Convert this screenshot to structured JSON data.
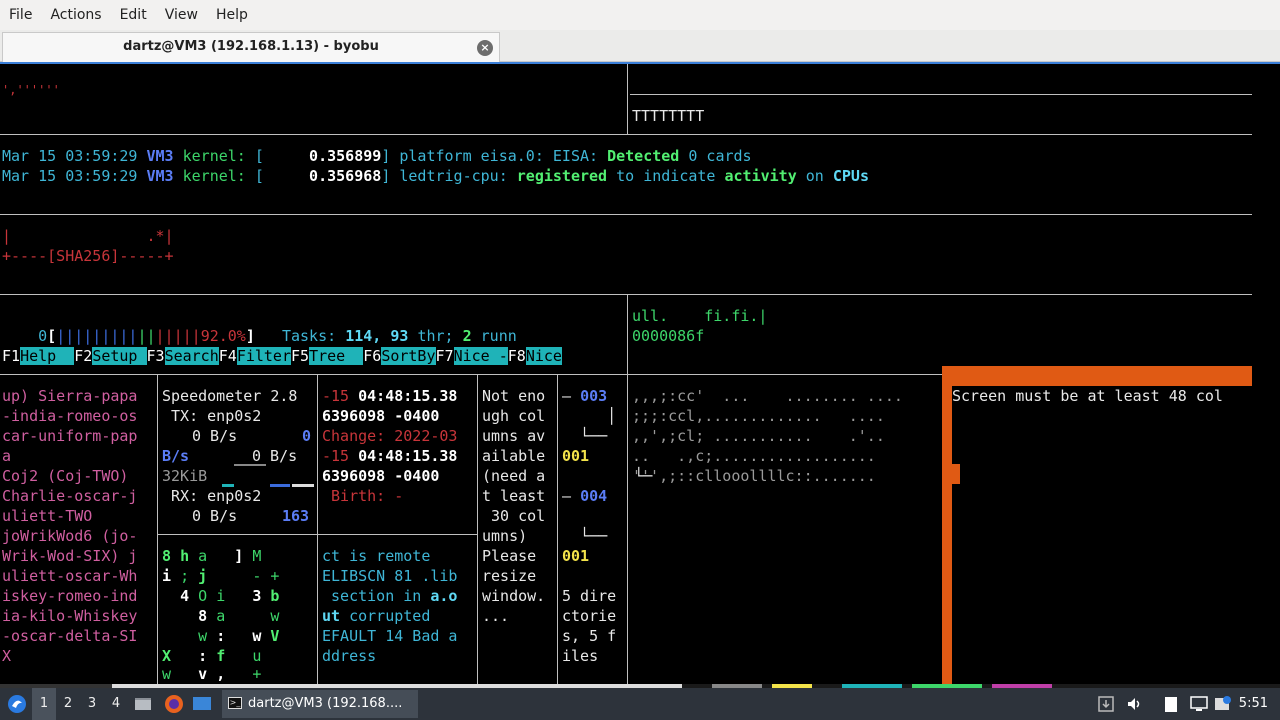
{
  "menu": [
    "File",
    "Actions",
    "Edit",
    "View",
    "Help"
  ],
  "tab": {
    "title": "dartz@VM3 (192.168.1.13) - byobu",
    "close": "×"
  },
  "pane_top": {
    "left_fragment": "',''''''",
    "right_text": "TTTTTTTT"
  },
  "log": [
    {
      "date": "Mar 15 03:59:29",
      "host": "VM3",
      "src": "kernel:",
      "open": "[",
      "time": "    0.356899",
      "close": "]",
      "msg1": "platform eisa.0: EISA:",
      "hl1": "Detected",
      "msg2": "0 cards",
      "hl2": "",
      "msg3": "",
      "hl3": ""
    },
    {
      "date": "Mar 15 03:59:29",
      "host": "VM3",
      "src": "kernel:",
      "open": "[",
      "time": "    0.356968",
      "close": "]",
      "msg1": "ledtrig-cpu:",
      "hl1": "registered",
      "msg2": "to indicate",
      "hl2": "activity",
      "msg3": "on",
      "hl3": "CPUs"
    }
  ],
  "sha": {
    "line1": "|               .*|",
    "line2": "+----[SHA256]-----+"
  },
  "htop": {
    "cpu_index": "0",
    "cpu_bar_open": "[",
    "cpu_bar_blue": "|||||||||",
    "cpu_bar_green": "||",
    "cpu_bar_red": "|||||",
    "cpu_pct": "92.0%",
    "cpu_bar_close": "]",
    "tasks_label": "Tasks:",
    "tasks_count": "114,",
    "threads": "93",
    "thr_label": "thr;",
    "running": "2",
    "run_label": "runn",
    "fkeys": [
      {
        "key": "F1",
        "label": "Help  "
      },
      {
        "key": "F2",
        "label": "Setup "
      },
      {
        "key": "F3",
        "label": "Search"
      },
      {
        "key": "F4",
        "label": "Filter"
      },
      {
        "key": "F5",
        "label": "Tree  "
      },
      {
        "key": "F6",
        "label": "SortBy"
      },
      {
        "key": "F7",
        "label": "Nice -"
      },
      {
        "key": "F8",
        "label": "Nice"
      }
    ]
  },
  "right_mid": {
    "line1": "ull.    fi.fi.|",
    "line2": "0000086f"
  },
  "col1": [
    "up) Sierra-papa",
    "-india-romeo-os",
    "car-uniform-pap",
    "a",
    "Coj2 (Coj-TWO)",
    "Charlie-oscar-j",
    "uliett-TWO",
    "joWrikWod6 (jo-",
    "Wrik-Wod-SIX) j",
    "uliett-oscar-Wh",
    "iskey-romeo-ind",
    "ia-kilo-Whiskey",
    "-oscar-delta-SI",
    "X"
  ],
  "speedo": {
    "title": "Speedometer 2.8",
    "tx_label": "TX: enp0s2",
    "tx_rate": "0 B/s",
    "tx_peak": "0",
    "bs_label": "B/s",
    "bs_rate": "0 B/s",
    "kib": "32KiB",
    "rx_label": "RX: enp0s2",
    "rx_rate": "0 B/s",
    "rx_peak": "163"
  },
  "matrix": [
    [
      "8",
      "h",
      "a",
      "",
      "]",
      "M"
    ],
    [
      "i",
      ";",
      "j",
      "",
      "-",
      "+"
    ],
    [
      "4",
      "O",
      "i",
      "3",
      "b",
      ""
    ],
    [
      "8",
      "a",
      "",
      "",
      "w",
      ""
    ],
    [
      "w",
      ":",
      "",
      "w",
      "V",
      ""
    ],
    [
      "X",
      ":",
      "f",
      "",
      "u",
      ""
    ],
    [
      "w",
      "v",
      ",",
      "",
      "+",
      ""
    ]
  ],
  "stat": {
    "l1a": "-15",
    "l1b": "04:48:15.38",
    "l2": "6396098 -0400",
    "l3": "Change: 2022-03",
    "l4a": "-15",
    "l4b": "04:48:15.38",
    "l5": "6396098 -0400",
    "l6": " Birth: -"
  },
  "errors": {
    "l1": "ct is remote",
    "l2a": "ELIBSCN 81",
    "l2b": ".lib",
    "l3a": " section in",
    "l3b": "a.o",
    "l4a": "ut",
    "l4b": "corrupted",
    "l5": "EFAULT 14 Bad a",
    "l6": "ddress"
  },
  "warning": [
    "Not eno",
    "ugh col",
    "umns av",
    "ailable",
    "(need a",
    "t least",
    " 30 col",
    "umns)",
    "Please",
    "resize",
    "window.",
    "..."
  ],
  "tree": {
    "n1": "003",
    "n2": "001",
    "n3": "004",
    "n4": "001",
    "summary": [
      "5 dire",
      "ctorie",
      "s, 5 f",
      "iles"
    ]
  },
  "ascii": [
    ",,,;:cc'  ...    ........ ....",
    ";;;:ccl,.............   ....",
    ",,',;cl; ...........    .'..",
    "..   .,c;..................",
    "''',;::cllooollllc::.......",
    ""
  ],
  "orange": {
    "message": "Screen must be at least 48 col"
  },
  "taskbar": {
    "workspaces": [
      "1",
      "2",
      "3",
      "4"
    ],
    "active_app": "dartz@VM3 (192.168....",
    "time": "5:51"
  }
}
